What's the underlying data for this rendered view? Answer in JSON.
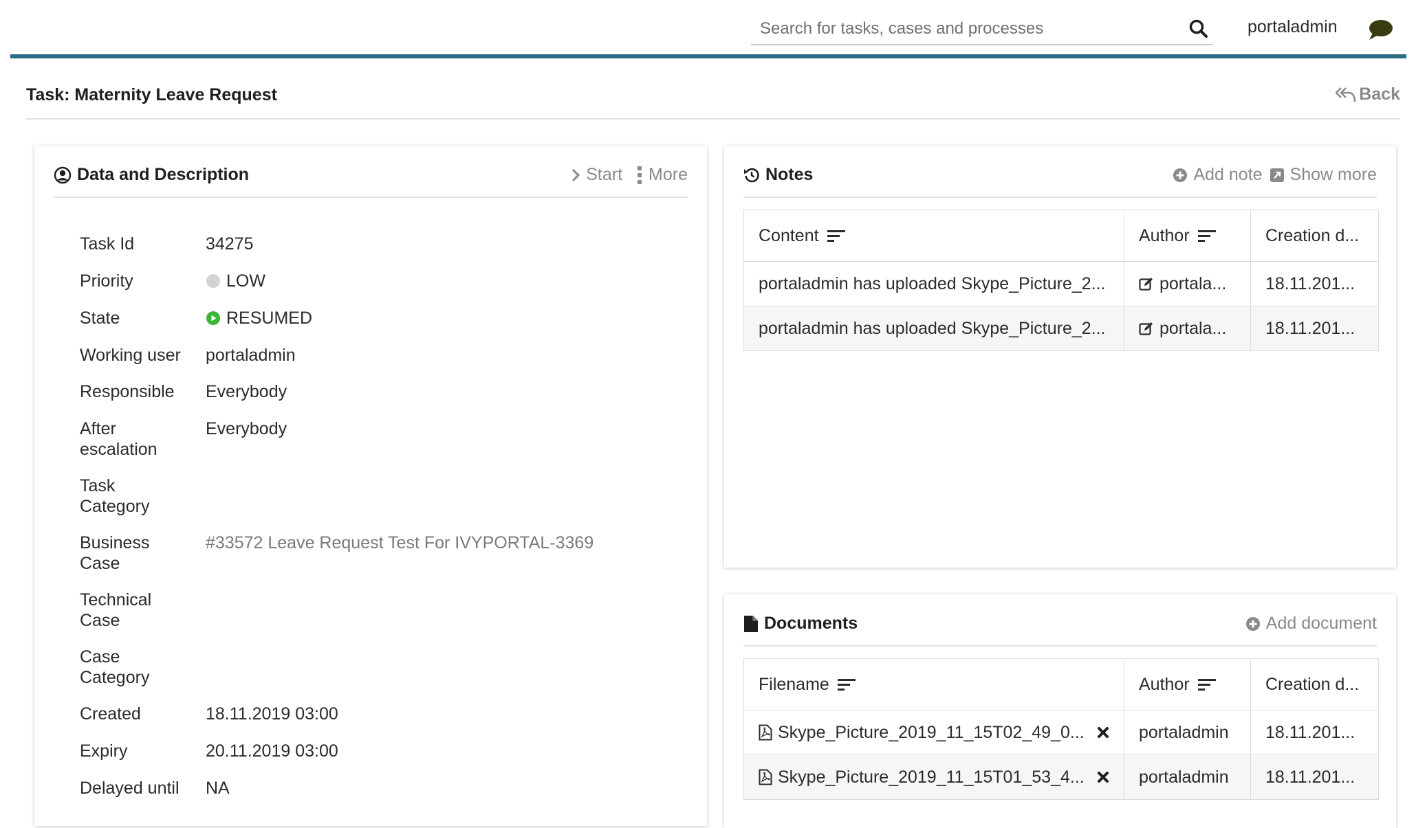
{
  "header": {
    "search_placeholder": "Search for tasks, cases and processes",
    "username": "portaladmin",
    "accent_color": "#2d6c86"
  },
  "page": {
    "title": "Task: Maternity Leave Request",
    "back_label": "Back"
  },
  "data_panel": {
    "title": "Data and Description",
    "start_label": "Start",
    "more_label": "More",
    "fields": {
      "task_id": {
        "label": "Task Id",
        "value": "34275"
      },
      "priority": {
        "label": "Priority",
        "value": "LOW"
      },
      "state": {
        "label": "State",
        "value": "RESUMED"
      },
      "working_user": {
        "label": "Working user",
        "value": "portaladmin"
      },
      "responsible": {
        "label": "Responsible",
        "value": "Everybody"
      },
      "after_escalation": {
        "label_line1": "After",
        "label_line2": "escalation",
        "value": "Everybody"
      },
      "task_category": {
        "label_line1": "Task",
        "label_line2": "Category"
      },
      "business_case": {
        "label_line1": "Business",
        "label_line2": "Case",
        "value": "#33572 Leave Request Test For IVYPORTAL-3369"
      },
      "technical_case": {
        "label_line1": "Technical",
        "label_line2": "Case"
      },
      "case_category": {
        "label_line1": "Case",
        "label_line2": "Category"
      },
      "created": {
        "label": "Created",
        "value": "18.11.2019 03:00"
      },
      "expiry": {
        "label": "Expiry",
        "value": "20.11.2019 03:00"
      },
      "delayed_until": {
        "label": "Delayed until",
        "value": "NA"
      }
    }
  },
  "notes": {
    "title": "Notes",
    "add_note_label": "Add note",
    "show_more_label": "Show more",
    "columns": {
      "content": "Content",
      "author": "Author",
      "created": "Creation d..."
    },
    "rows": [
      {
        "content": "portaladmin has uploaded Skype_Picture_2...",
        "author": "portala...",
        "created": "18.11.201..."
      },
      {
        "content": "portaladmin has uploaded Skype_Picture_2...",
        "author": "portala...",
        "created": "18.11.201..."
      }
    ]
  },
  "documents": {
    "title": "Documents",
    "add_document_label": "Add document",
    "columns": {
      "filename": "Filename",
      "author": "Author",
      "created": "Creation d..."
    },
    "rows": [
      {
        "filename": "Skype_Picture_2019_11_15T02_49_0...",
        "author": "portaladmin",
        "created": "18.11.201..."
      },
      {
        "filename": "Skype_Picture_2019_11_15T01_53_4...",
        "author": "portaladmin",
        "created": "18.11.201..."
      }
    ]
  }
}
